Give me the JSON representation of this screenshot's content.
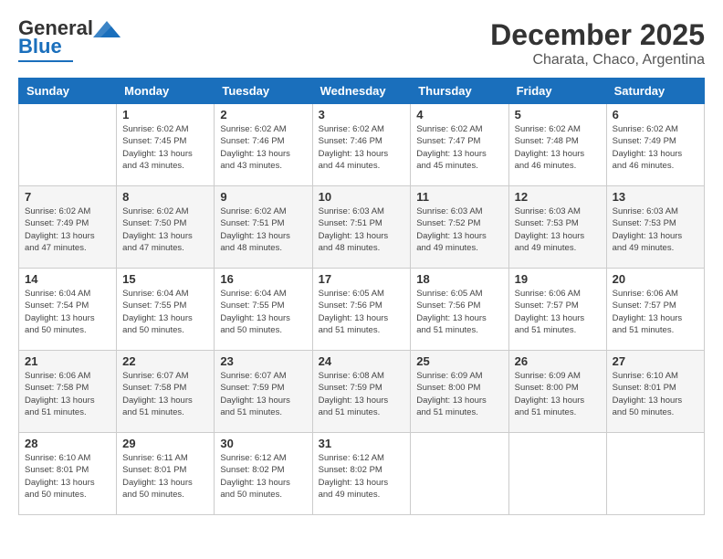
{
  "logo": {
    "text_general": "General",
    "text_blue": "Blue"
  },
  "header": {
    "month": "December 2025",
    "location": "Charata, Chaco, Argentina"
  },
  "weekdays": [
    "Sunday",
    "Monday",
    "Tuesday",
    "Wednesday",
    "Thursday",
    "Friday",
    "Saturday"
  ],
  "weeks": [
    [
      {
        "day": "",
        "info": ""
      },
      {
        "day": "1",
        "info": "Sunrise: 6:02 AM\nSunset: 7:45 PM\nDaylight: 13 hours\nand 43 minutes."
      },
      {
        "day": "2",
        "info": "Sunrise: 6:02 AM\nSunset: 7:46 PM\nDaylight: 13 hours\nand 43 minutes."
      },
      {
        "day": "3",
        "info": "Sunrise: 6:02 AM\nSunset: 7:46 PM\nDaylight: 13 hours\nand 44 minutes."
      },
      {
        "day": "4",
        "info": "Sunrise: 6:02 AM\nSunset: 7:47 PM\nDaylight: 13 hours\nand 45 minutes."
      },
      {
        "day": "5",
        "info": "Sunrise: 6:02 AM\nSunset: 7:48 PM\nDaylight: 13 hours\nand 46 minutes."
      },
      {
        "day": "6",
        "info": "Sunrise: 6:02 AM\nSunset: 7:49 PM\nDaylight: 13 hours\nand 46 minutes."
      }
    ],
    [
      {
        "day": "7",
        "info": "Sunrise: 6:02 AM\nSunset: 7:49 PM\nDaylight: 13 hours\nand 47 minutes."
      },
      {
        "day": "8",
        "info": "Sunrise: 6:02 AM\nSunset: 7:50 PM\nDaylight: 13 hours\nand 47 minutes."
      },
      {
        "day": "9",
        "info": "Sunrise: 6:02 AM\nSunset: 7:51 PM\nDaylight: 13 hours\nand 48 minutes."
      },
      {
        "day": "10",
        "info": "Sunrise: 6:03 AM\nSunset: 7:51 PM\nDaylight: 13 hours\nand 48 minutes."
      },
      {
        "day": "11",
        "info": "Sunrise: 6:03 AM\nSunset: 7:52 PM\nDaylight: 13 hours\nand 49 minutes."
      },
      {
        "day": "12",
        "info": "Sunrise: 6:03 AM\nSunset: 7:53 PM\nDaylight: 13 hours\nand 49 minutes."
      },
      {
        "day": "13",
        "info": "Sunrise: 6:03 AM\nSunset: 7:53 PM\nDaylight: 13 hours\nand 49 minutes."
      }
    ],
    [
      {
        "day": "14",
        "info": "Sunrise: 6:04 AM\nSunset: 7:54 PM\nDaylight: 13 hours\nand 50 minutes."
      },
      {
        "day": "15",
        "info": "Sunrise: 6:04 AM\nSunset: 7:55 PM\nDaylight: 13 hours\nand 50 minutes."
      },
      {
        "day": "16",
        "info": "Sunrise: 6:04 AM\nSunset: 7:55 PM\nDaylight: 13 hours\nand 50 minutes."
      },
      {
        "day": "17",
        "info": "Sunrise: 6:05 AM\nSunset: 7:56 PM\nDaylight: 13 hours\nand 51 minutes."
      },
      {
        "day": "18",
        "info": "Sunrise: 6:05 AM\nSunset: 7:56 PM\nDaylight: 13 hours\nand 51 minutes."
      },
      {
        "day": "19",
        "info": "Sunrise: 6:06 AM\nSunset: 7:57 PM\nDaylight: 13 hours\nand 51 minutes."
      },
      {
        "day": "20",
        "info": "Sunrise: 6:06 AM\nSunset: 7:57 PM\nDaylight: 13 hours\nand 51 minutes."
      }
    ],
    [
      {
        "day": "21",
        "info": "Sunrise: 6:06 AM\nSunset: 7:58 PM\nDaylight: 13 hours\nand 51 minutes."
      },
      {
        "day": "22",
        "info": "Sunrise: 6:07 AM\nSunset: 7:58 PM\nDaylight: 13 hours\nand 51 minutes."
      },
      {
        "day": "23",
        "info": "Sunrise: 6:07 AM\nSunset: 7:59 PM\nDaylight: 13 hours\nand 51 minutes."
      },
      {
        "day": "24",
        "info": "Sunrise: 6:08 AM\nSunset: 7:59 PM\nDaylight: 13 hours\nand 51 minutes."
      },
      {
        "day": "25",
        "info": "Sunrise: 6:09 AM\nSunset: 8:00 PM\nDaylight: 13 hours\nand 51 minutes."
      },
      {
        "day": "26",
        "info": "Sunrise: 6:09 AM\nSunset: 8:00 PM\nDaylight: 13 hours\nand 51 minutes."
      },
      {
        "day": "27",
        "info": "Sunrise: 6:10 AM\nSunset: 8:01 PM\nDaylight: 13 hours\nand 50 minutes."
      }
    ],
    [
      {
        "day": "28",
        "info": "Sunrise: 6:10 AM\nSunset: 8:01 PM\nDaylight: 13 hours\nand 50 minutes."
      },
      {
        "day": "29",
        "info": "Sunrise: 6:11 AM\nSunset: 8:01 PM\nDaylight: 13 hours\nand 50 minutes."
      },
      {
        "day": "30",
        "info": "Sunrise: 6:12 AM\nSunset: 8:02 PM\nDaylight: 13 hours\nand 50 minutes."
      },
      {
        "day": "31",
        "info": "Sunrise: 6:12 AM\nSunset: 8:02 PM\nDaylight: 13 hours\nand 49 minutes."
      },
      {
        "day": "",
        "info": ""
      },
      {
        "day": "",
        "info": ""
      },
      {
        "day": "",
        "info": ""
      }
    ]
  ]
}
